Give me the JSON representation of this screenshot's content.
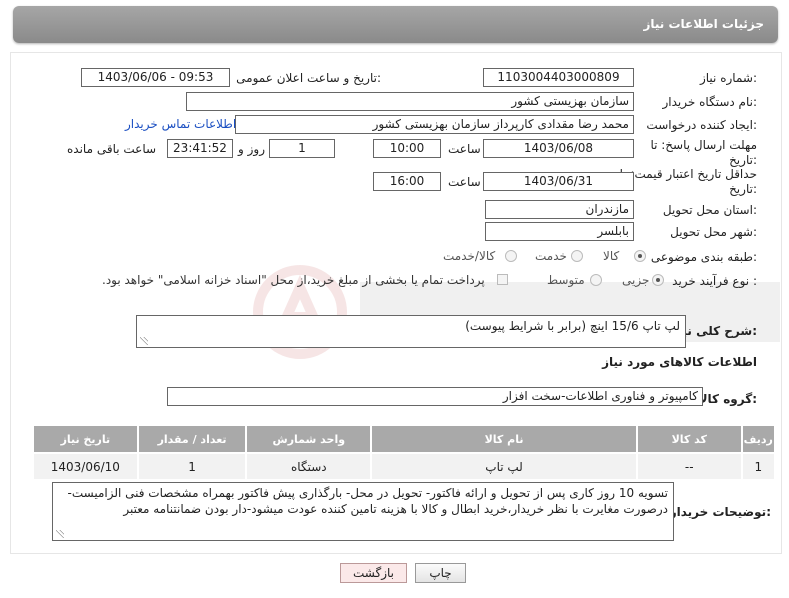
{
  "header": {
    "title": "جزئیات اطلاعات نیاز"
  },
  "fields": {
    "need_number_label": "شماره نیاز:",
    "need_number": "1103004403000809",
    "announce_label": "تاریخ و ساعت اعلان عمومی:",
    "announce_value": "1403/06/06 - 09:53",
    "buyer_org_label": "نام دستگاه خریدار:",
    "buyer_org": "سازمان بهزیستی کشور",
    "requester_label": "ایجاد کننده درخواست:",
    "requester": "محمد رضا  مقدادی کارپرداز سازمان بهزیستی کشور",
    "contact_link": "اطلاعات تماس خریدار",
    "deadline_label_1": "مهلت ارسال پاسخ: تا",
    "deadline_label_2": "تاریخ:",
    "deadline_date": "1403/06/08",
    "time_label": "ساعت",
    "deadline_time": "10:00",
    "days_value": "1",
    "days_label": "روز و",
    "remaining_time": "23:41:52",
    "remaining_label": "ساعت باقی مانده",
    "validity_label_1": "حداقل تاریخ اعتبار قیمت: تا",
    "validity_label_2": "تاریخ:",
    "validity_date": "1403/06/31",
    "validity_time_label": "ساعت",
    "validity_time": "16:00",
    "province_label": "استان محل تحویل:",
    "province": "مازندران",
    "city_label": "شهر محل تحویل:",
    "city": "بابلسر",
    "category_label": "طبقه بندی موضوعی:",
    "category_options": [
      "کالا",
      "خدمت",
      "کالا/خدمت"
    ],
    "category_selected": "کالا",
    "process_label": "نوع فرآیند خرید :",
    "process_options": [
      "جزیی",
      "متوسط"
    ],
    "process_selected": "جزیی",
    "payment_note": "پرداخت تمام یا بخشی از مبلغ خرید،از محل \"اسناد خزانه اسلامی\" خواهد بود.",
    "description_label": "شرح کلی نیاز:",
    "description": "لپ تاپ 15/6 اینچ (برابر با شرایط پیوست)"
  },
  "goods": {
    "section_title": "اطلاعات کالاهای مورد نیاز",
    "group_label": "گروه کالا:",
    "group_value": "کامپیوتر و فناوری اطلاعات-سخت افزار",
    "columns": [
      "ردیف",
      "کد کالا",
      "نام کالا",
      "واحد شمارش",
      "تعداد / مقدار",
      "تاریخ نیاز"
    ],
    "rows": [
      [
        "1",
        "--",
        "لپ تاپ",
        "دستگاه",
        "1",
        "1403/06/10"
      ]
    ]
  },
  "buyer_notes": {
    "label": "توضیحات خریدار:",
    "text": "تسویه 10 روز کاری پس از تحویل و ارائه فاکتور- تحویل در محل- بارگذاری پیش فاکتور بهمراه مشخصات فنی الزامیست-درصورت مغایرت با نظر خریدار،خرید ابطال و کالا با هزینه تامین کننده عودت میشود-دار بودن ضمانتنامه معتبر"
  },
  "buttons": {
    "print": "چاپ",
    "back": "بازگشت"
  },
  "colors": {
    "header_bg": "#999999",
    "link": "#1b4fc2",
    "table_header": "#a9a9a9"
  }
}
